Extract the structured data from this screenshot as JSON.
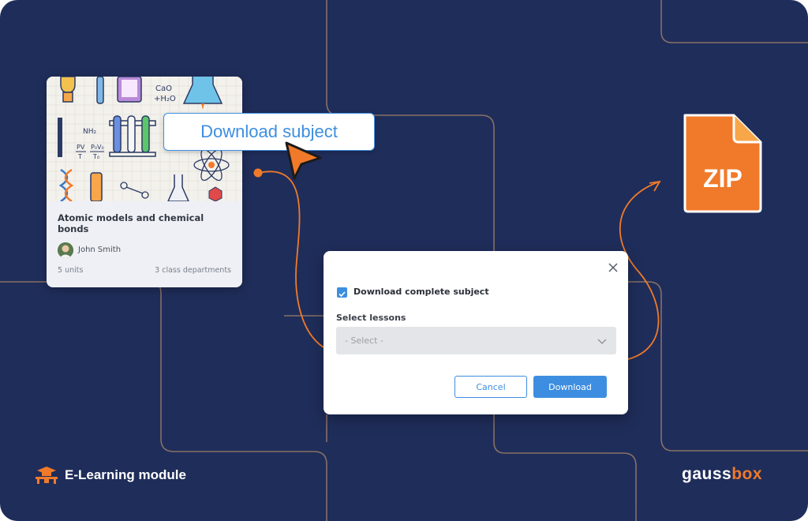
{
  "card": {
    "title": "Atomic models and chemical bonds",
    "author": "John Smith",
    "units": "5 units",
    "departments": "3 class departments",
    "illustration_labels": {
      "formula_cao": "CaO",
      "formula_h2o": "+H₂O",
      "formula_nh2": "NH₂",
      "formula_gas_law_lhs": "PV",
      "formula_gas_law_rhs": "P₀V₀",
      "formula_t": "T",
      "formula_t0": "T₀"
    }
  },
  "tooltip": {
    "text": "Download subject"
  },
  "zip_icon": {
    "label": "ZIP"
  },
  "dialog": {
    "checkbox_label": "Download complete subject",
    "checkbox_checked": true,
    "select_label": "Select lessons",
    "select_placeholder": "- Select -",
    "cancel_label": "Cancel",
    "download_label": "Download"
  },
  "footer": {
    "module_label": "E-Learning module",
    "brand_main": "gauss",
    "brand_accent": "box"
  },
  "colors": {
    "background": "#1f2d5a",
    "accent_orange": "#f07a2a",
    "accent_blue": "#3d8ee0",
    "line_tan": "#b08a6a"
  },
  "icons": [
    "arrow-cursor-icon",
    "zip-file-icon",
    "close-icon",
    "chevron-down-icon",
    "check-icon",
    "graduation-desk-icon"
  ]
}
